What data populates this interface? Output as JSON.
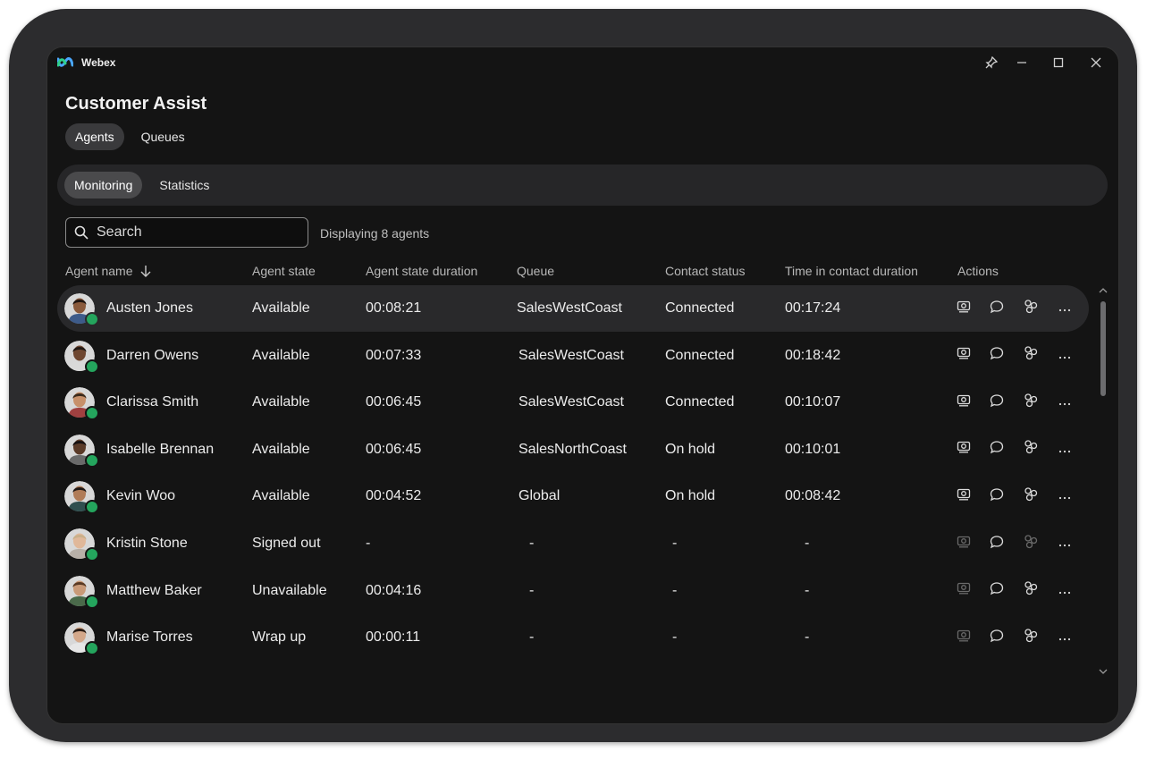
{
  "app": {
    "name": "Webex"
  },
  "page": {
    "title": "Customer Assist"
  },
  "tabs_primary": [
    {
      "label": "Agents",
      "active": true
    },
    {
      "label": "Queues",
      "active": false
    }
  ],
  "tabs_secondary": [
    {
      "label": "Monitoring",
      "active": true
    },
    {
      "label": "Statistics",
      "active": false
    }
  ],
  "search": {
    "placeholder": "Search",
    "value": ""
  },
  "display_count": "Displaying 8 agents",
  "columns": {
    "agent_name": "Agent name",
    "agent_state": "Agent state",
    "agent_state_duration": "Agent state duration",
    "queue": "Queue",
    "contact_status": "Contact status",
    "time_in_contact": "Time in contact duration",
    "actions": "Actions"
  },
  "agents": [
    {
      "name": "Austen Jones",
      "state": "Available",
      "state_duration": "00:08:21",
      "queue": "SalesWestCoast",
      "contact_status": "Connected",
      "contact_duration": "00:17:24",
      "selected": true,
      "monitor_enabled": true,
      "conference_enabled": true
    },
    {
      "name": "Darren Owens",
      "state": "Available",
      "state_duration": "00:07:33",
      "queue": "SalesWestCoast",
      "contact_status": "Connected",
      "contact_duration": "00:18:42",
      "selected": false,
      "monitor_enabled": true,
      "conference_enabled": true
    },
    {
      "name": "Clarissa Smith",
      "state": "Available",
      "state_duration": "00:06:45",
      "queue": "SalesWestCoast",
      "contact_status": "Connected",
      "contact_duration": "00:10:07",
      "selected": false,
      "monitor_enabled": true,
      "conference_enabled": true
    },
    {
      "name": "Isabelle Brennan",
      "state": "Available",
      "state_duration": "00:06:45",
      "queue": "SalesNorthCoast",
      "contact_status": "On hold",
      "contact_duration": "00:10:01",
      "selected": false,
      "monitor_enabled": true,
      "conference_enabled": true
    },
    {
      "name": "Kevin Woo",
      "state": "Available",
      "state_duration": "00:04:52",
      "queue": "Global",
      "contact_status": "On hold",
      "contact_duration": "00:08:42",
      "selected": false,
      "monitor_enabled": true,
      "conference_enabled": true
    },
    {
      "name": "Kristin Stone",
      "state": "Signed out",
      "state_duration": "-",
      "queue": "-",
      "contact_status": "-",
      "contact_duration": "-",
      "selected": false,
      "monitor_enabled": false,
      "conference_enabled": false
    },
    {
      "name": "Matthew Baker",
      "state": "Unavailable",
      "state_duration": "00:04:16",
      "queue": "-",
      "contact_status": "-",
      "contact_duration": "-",
      "selected": false,
      "monitor_enabled": false,
      "conference_enabled": true
    },
    {
      "name": "Marise Torres",
      "state": "Wrap up",
      "state_duration": "00:00:11",
      "queue": "-",
      "contact_status": "-",
      "contact_duration": "-",
      "selected": false,
      "monitor_enabled": false,
      "conference_enabled": true
    }
  ],
  "action_icons": [
    "monitor-icon",
    "chat-icon",
    "conference-icon",
    "more-icon"
  ],
  "window_controls": [
    "pin-icon",
    "minimize-icon",
    "maximize-icon",
    "close-icon"
  ],
  "colors": {
    "background": "#141414",
    "selected_row": "#29292b",
    "presence": "#24a55d",
    "pill_active": "#3a3a3c"
  }
}
